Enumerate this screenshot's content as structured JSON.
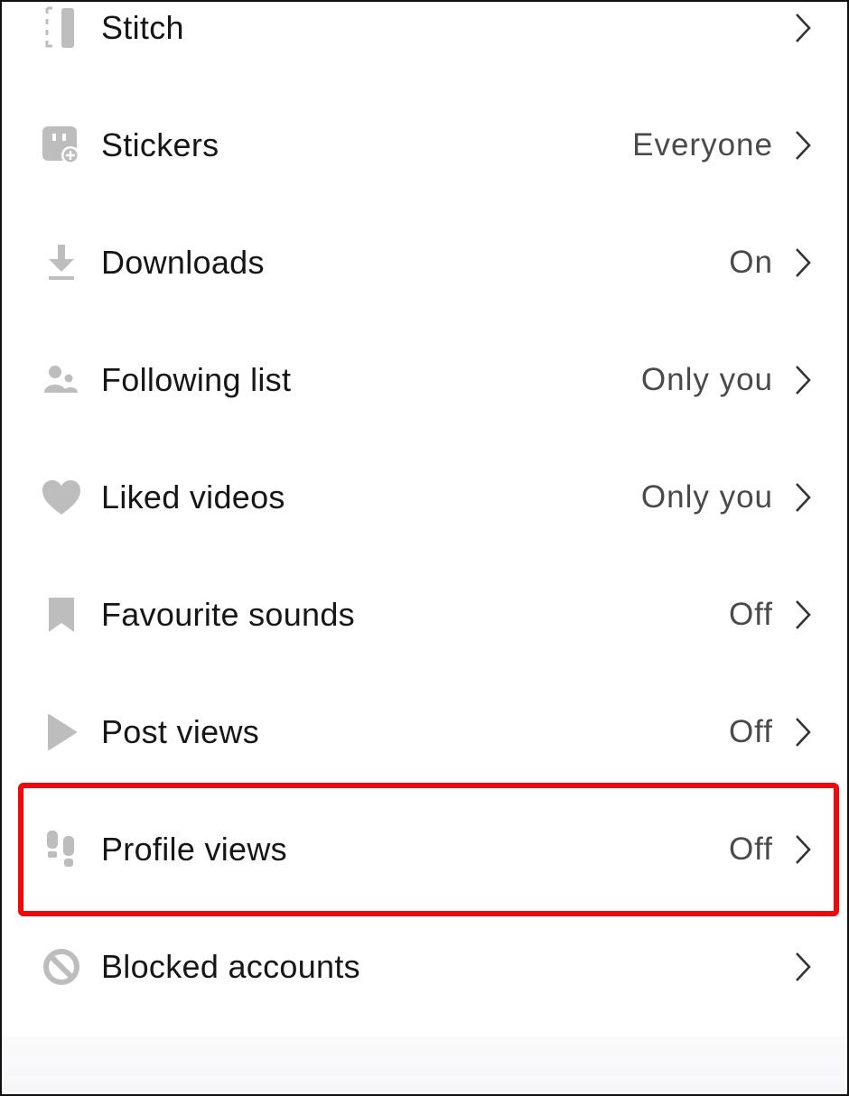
{
  "settings": {
    "rows": [
      {
        "icon": "stitch-icon",
        "label": "Stitch",
        "value": ""
      },
      {
        "icon": "stickers-icon",
        "label": "Stickers",
        "value": "Everyone"
      },
      {
        "icon": "download-icon",
        "label": "Downloads",
        "value": "On"
      },
      {
        "icon": "following-list-icon",
        "label": "Following list",
        "value": "Only you"
      },
      {
        "icon": "heart-icon",
        "label": "Liked videos",
        "value": "Only you"
      },
      {
        "icon": "bookmark-icon",
        "label": "Favourite sounds",
        "value": "Off"
      },
      {
        "icon": "play-icon",
        "label": "Post views",
        "value": "Off"
      },
      {
        "icon": "footprints-icon",
        "label": "Profile views",
        "value": "Off"
      },
      {
        "icon": "blocked-icon",
        "label": "Blocked accounts",
        "value": ""
      }
    ],
    "highlighted_row": "Profile views"
  },
  "colors": {
    "icon_gray": "#bdbdbd",
    "highlight_red": "#ee0a0a",
    "label_text": "#161616",
    "value_text": "#4a4a4a"
  }
}
